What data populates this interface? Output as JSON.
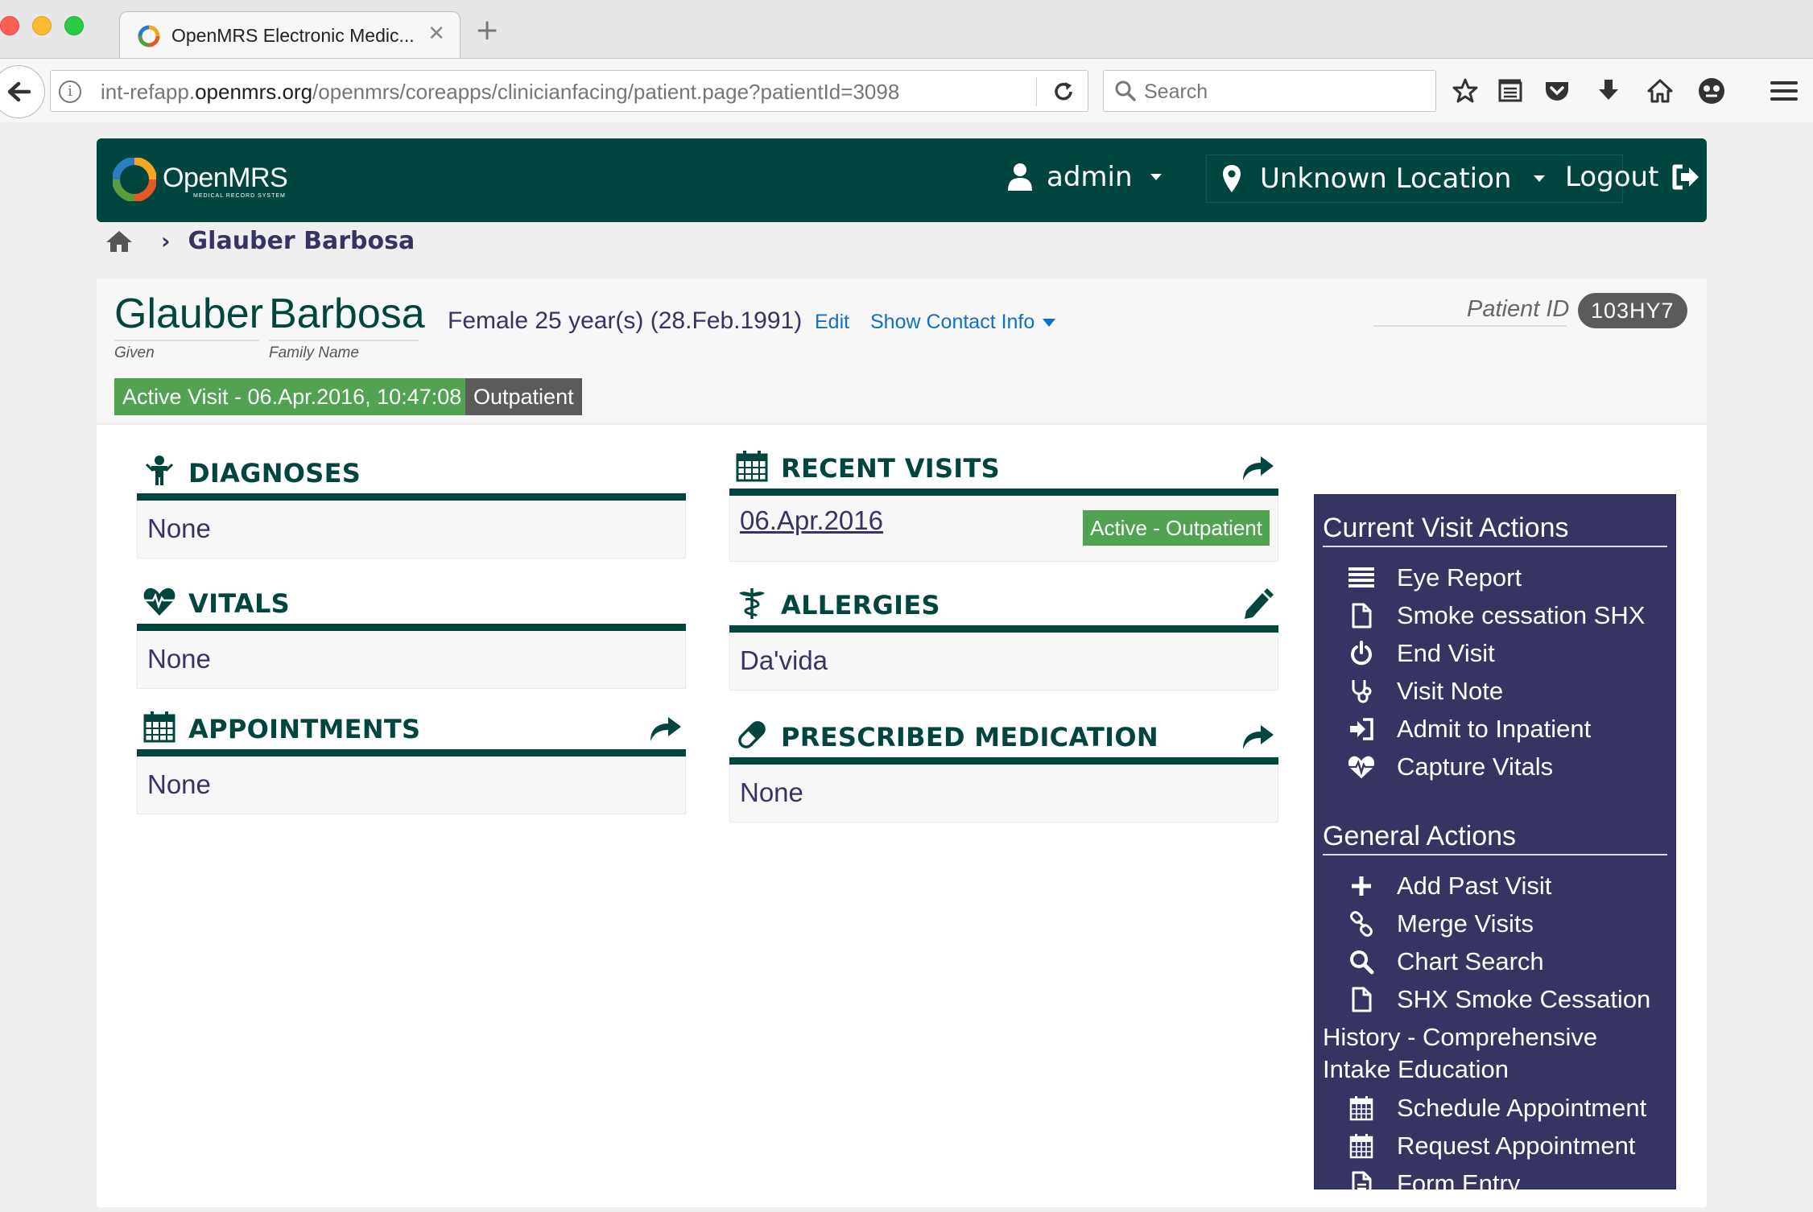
{
  "browser": {
    "tab_title": "OpenMRS Electronic Medic...",
    "url_prefix": "int-refapp.",
    "url_domain": "openmrs.org",
    "url_path": "/openmrs/coreapps/clinicianfacing/patient.page?patientId=3098",
    "search_placeholder": "Search"
  },
  "header": {
    "logo_text": "OpenMRS",
    "logo_sub": "MEDICAL RECORD SYSTEM",
    "user": "admin",
    "location": "Unknown Location",
    "logout": "Logout"
  },
  "breadcrumb": {
    "current": "Glauber Barbosa"
  },
  "patient": {
    "given": "Glauber",
    "family": "Barbosa",
    "given_label": "Given",
    "family_label": "Family Name",
    "demographics": "Female  25 year(s) (28.Feb.1991)",
    "edit_link": "Edit",
    "contact_link": "Show Contact Info",
    "id_label": "Patient ID",
    "id_value": "103HY7",
    "active_visit": "Active Visit - 06.Apr.2016, 10:47:08",
    "visit_type": "Outpatient"
  },
  "widgets": {
    "diagnoses": {
      "title": "DIAGNOSES",
      "value": "None"
    },
    "vitals": {
      "title": "VITALS",
      "value": "None"
    },
    "appointments": {
      "title": "APPOINTMENTS",
      "value": "None"
    },
    "recent_visits": {
      "title": "RECENT VISITS",
      "visit_date": "06.Apr.2016",
      "visit_badge": "Active - Outpatient"
    },
    "allergies": {
      "title": "ALLERGIES",
      "value": "Da'vida"
    },
    "medication": {
      "title": "PRESCRIBED MEDICATION",
      "value": "None"
    }
  },
  "current_visit_actions": {
    "heading": "Current Visit Actions",
    "items": [
      {
        "label": "Eye Report",
        "icon": "list-icon"
      },
      {
        "label": "Smoke cessation SHX",
        "icon": "file-icon"
      },
      {
        "label": "End Visit",
        "icon": "power-icon"
      },
      {
        "label": "Visit Note",
        "icon": "stethoscope-icon"
      },
      {
        "label": "Admit to Inpatient",
        "icon": "sign-in-icon"
      },
      {
        "label": "Capture Vitals",
        "icon": "heartbeat-icon"
      }
    ]
  },
  "general_actions": {
    "heading": "General Actions",
    "items": [
      {
        "label": "Add Past Visit",
        "icon": "plus-icon"
      },
      {
        "label": "Merge Visits",
        "icon": "link-icon"
      },
      {
        "label": "Chart Search",
        "icon": "search-icon"
      },
      {
        "label": "SHX Smoke Cessation",
        "icon": "file-icon"
      },
      {
        "label": "History - Comprehensive Intake Education",
        "icon": ""
      },
      {
        "label": "Schedule Appointment",
        "icon": "calendar-icon"
      },
      {
        "label": "Request Appointment",
        "icon": "calendar-icon"
      },
      {
        "label": "Form Entry",
        "icon": "file-text-icon"
      }
    ]
  },
  "colors": {
    "header_green": "#00463f",
    "navy": "#363463",
    "badge_green": "#51a351",
    "badge_gray": "#5b5b5b",
    "link_blue": "#0f6fc6"
  }
}
